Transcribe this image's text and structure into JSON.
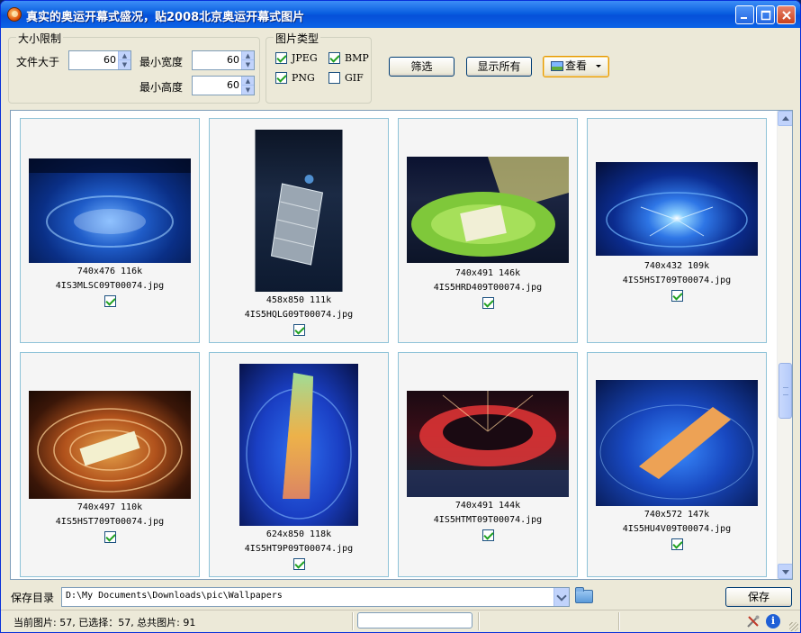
{
  "window": {
    "title": "真实的奥运开幕式盛况，贴2008北京奥运开幕式图片"
  },
  "size_limit": {
    "group_label": "大小限制",
    "file_size_label": "文件大于",
    "file_size_value": "60",
    "min_width_label": "最小宽度",
    "min_width_value": "60",
    "min_height_label": "最小高度",
    "min_height_value": "60"
  },
  "image_type": {
    "group_label": "图片类型",
    "jpeg": "JPEG",
    "bmp": "BMP",
    "png": "PNG",
    "gif": "GIF"
  },
  "buttons": {
    "filter": "筛选",
    "show_all": "显示所有",
    "view": "查看",
    "save": "保存"
  },
  "images": [
    {
      "dims": "740x476 116k",
      "filename": "4IS3MLSC09T00074.jpg",
      "checked": true
    },
    {
      "dims": "458x850 111k",
      "filename": "4IS5HQLG09T00074.jpg",
      "checked": true
    },
    {
      "dims": "740x491 146k",
      "filename": "4IS5HRD409T00074.jpg",
      "checked": true
    },
    {
      "dims": "740x432 109k",
      "filename": "4IS5HSI709T00074.jpg",
      "checked": true
    },
    {
      "dims": "740x497 110k",
      "filename": "4IS5HST709T00074.jpg",
      "checked": true
    },
    {
      "dims": "624x850 118k",
      "filename": "4IS5HT9P09T00074.jpg",
      "checked": true
    },
    {
      "dims": "740x491 144k",
      "filename": "4IS5HTMT09T00074.jpg",
      "checked": true
    },
    {
      "dims": "740x572 147k",
      "filename": "4IS5HU4V09T00074.jpg",
      "checked": true
    }
  ],
  "save": {
    "label": "保存目录",
    "path": "D:\\My Documents\\Downloads\\pic\\Wallpapers"
  },
  "status": {
    "text": "当前图片: 57, 已选择：57, 总共图片: 91"
  }
}
